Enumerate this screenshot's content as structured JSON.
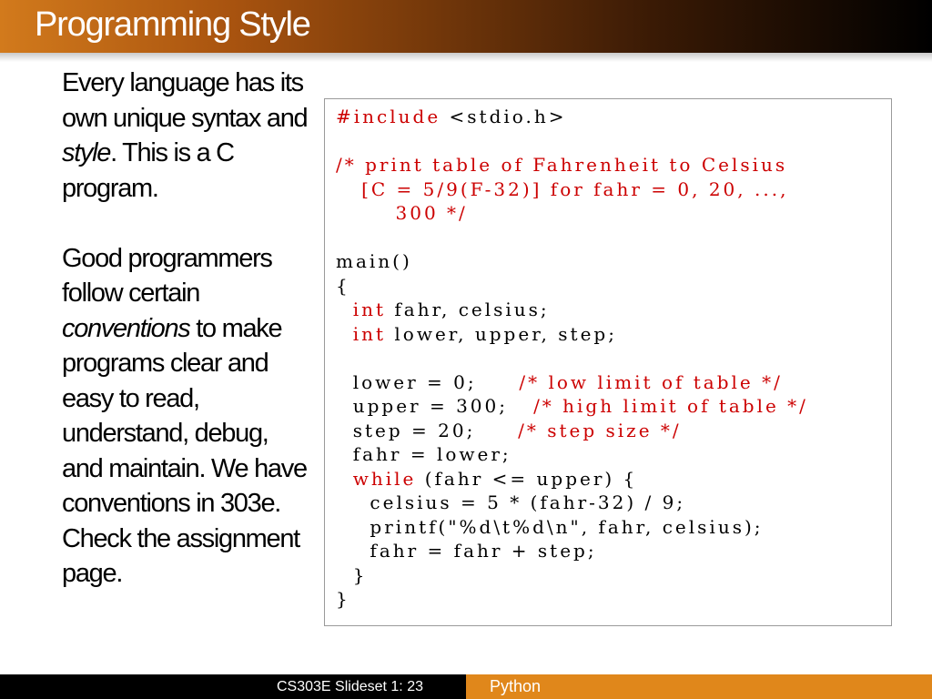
{
  "slide": {
    "title": "Programming Style"
  },
  "left_text": {
    "p1_a": "Every language has its own unique syntax and ",
    "p1_style": "style",
    "p1_b": ". This is a C program.",
    "p2_a": "Good programmers follow certain ",
    "p2_conventions": "conventions",
    "p2_b": " to make programs clear and easy to read, understand, debug, and maintain. We have conventions in 303e. Check the assignment page."
  },
  "code": {
    "include_kw": "#include",
    "include_rest": " <stdio.h>",
    "comment_block": "/* print table of Fahrenheit to Celsius\n   [C = 5/9(F-32)] for fahr = 0, 20, ...,\n       300 */",
    "main_sig": "main()",
    "open_brace": "{",
    "int_kw": "int",
    "decl1_rest": " fahr, celsius;",
    "decl2_rest": " lower, upper, step;",
    "assign1": "  lower = 0;     ",
    "comment1": "/* low limit of table */",
    "assign2": "  upper = 300;   ",
    "comment2": "/* high limit of table */",
    "assign3": "  step = 20;     ",
    "comment3": "/* step size */",
    "assign4": "  fahr = lower;",
    "while_kw": "while",
    "while_rest": " (fahr <= upper) {",
    "body1": "    celsius = 5 * (fahr-32) / 9;",
    "body2": "    printf(\"%d\\t%d\\n\", fahr, celsius);",
    "body3": "    fahr = fahr + step;",
    "inner_close": "  }",
    "close_brace": "}"
  },
  "footer": {
    "left": "CS303E Slideset 1: 23",
    "right": "Python"
  },
  "colors": {
    "title_orange": "#d27a1c",
    "keyword_red": "#cc0000",
    "footer_orange": "#e0871b"
  }
}
